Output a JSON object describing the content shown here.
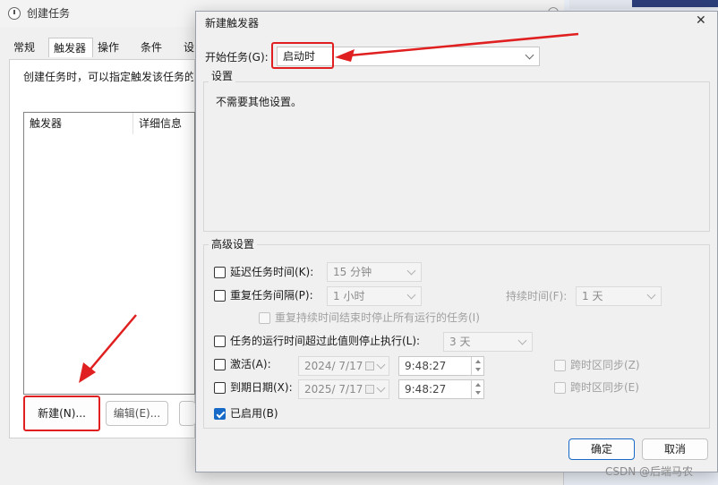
{
  "background_window": {
    "title": "创建任务",
    "tabs": [
      "常规",
      "触发器",
      "操作",
      "条件",
      "设"
    ],
    "description": "创建任务时，可以指定触发该任务的",
    "columns": [
      "触发器",
      "详细信息"
    ],
    "new_button": "新建(N)...",
    "edit_button": "编辑(E)..."
  },
  "dialog": {
    "title": "新建触发器",
    "close_glyph": "✕",
    "begin_task_label": "开始任务(G):",
    "begin_task_value": "启动时",
    "settings_group": "设置",
    "settings_text": "不需要其他设置。",
    "advanced_group": "高级设置",
    "delay": {
      "label": "延迟任务时间(K):",
      "value": "15 分钟"
    },
    "repeat": {
      "label": "重复任务间隔(P):",
      "value": "1 小时",
      "duration_label": "持续时间(F):",
      "duration_value": "1 天"
    },
    "stop_all": {
      "label": "重复持续时间结束时停止所有运行的任务(I)"
    },
    "stop_after": {
      "label": "任务的运行时间超过此值则停止执行(L):",
      "value": "3 天"
    },
    "activate": {
      "label": "激活(A):",
      "date": "2024/ 7/17",
      "time": "9:48:27",
      "sync": "跨时区同步(Z)"
    },
    "expire": {
      "label": "到期日期(X):",
      "date": "2025/ 7/17",
      "time": "9:48:27",
      "sync": "跨时区同步(E)"
    },
    "enabled": {
      "label": "已启用(B)",
      "checked": true
    },
    "ok_button": "确定",
    "cancel_button": "取消"
  },
  "watermark": "CSDN @后端马农",
  "colors": {
    "accent": "#1769c7",
    "annotation": "#e02020"
  }
}
